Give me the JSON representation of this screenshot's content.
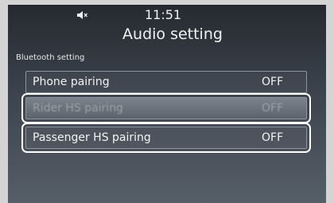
{
  "status_bar": {
    "mute_icon": "speaker-mute-icon",
    "time": "11:51"
  },
  "header": {
    "title": "Audio setting"
  },
  "section": {
    "label": "Bluetooth setting"
  },
  "settings": [
    {
      "label": "Phone pairing",
      "value": "OFF",
      "state": "normal"
    },
    {
      "label": "Rider HS pairing",
      "value": "OFF",
      "state": "disabled"
    },
    {
      "label": "Passenger HS pairing",
      "value": "OFF",
      "state": "normal"
    }
  ],
  "colors": {
    "text": "#f2f2f2",
    "row_border": "#8a939e",
    "highlight": "#ffffff"
  }
}
